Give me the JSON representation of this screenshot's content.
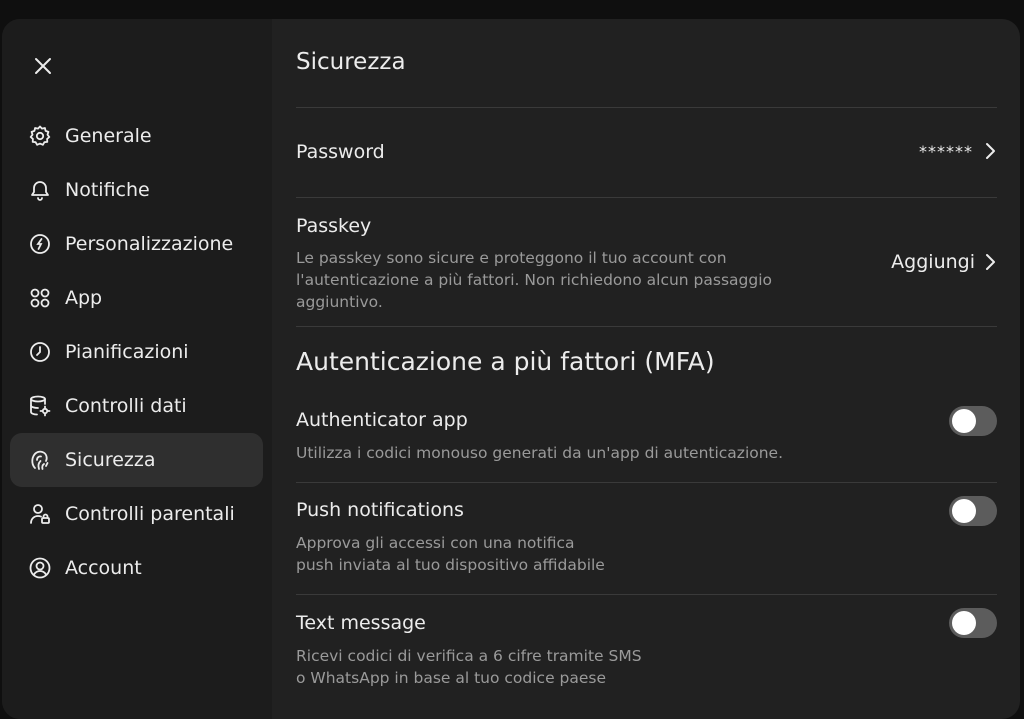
{
  "sidebar": {
    "items": [
      {
        "label": "Generale",
        "icon": "gear-icon"
      },
      {
        "label": "Notifiche",
        "icon": "bell-icon"
      },
      {
        "label": "Personalizzazione",
        "icon": "personalization-icon"
      },
      {
        "label": "App",
        "icon": "apps-grid-icon"
      },
      {
        "label": "Pianificazioni",
        "icon": "clock-icon"
      },
      {
        "label": "Controlli dati",
        "icon": "database-gear-icon"
      },
      {
        "label": "Sicurezza",
        "icon": "security-icon",
        "active": true
      },
      {
        "label": "Controlli parentali",
        "icon": "parent-lock-icon"
      },
      {
        "label": "Account",
        "icon": "user-circle-icon"
      }
    ]
  },
  "main": {
    "title": "Sicurezza",
    "password": {
      "label": "Password",
      "value": "******"
    },
    "passkey": {
      "label": "Passkey",
      "description_line1": "Le passkey sono sicure e proteggono il tuo account con",
      "description_line2": "l'autenticazione a più fattori. Non richiedono alcun passaggio",
      "description_line3": "aggiuntivo.",
      "action": "Aggiungi"
    },
    "mfa": {
      "title": "Autenticazione a più fattori (MFA)",
      "authenticator": {
        "label": "Authenticator app",
        "description": "Utilizza i codici monouso generati da un'app di autenticazione.",
        "enabled": false
      },
      "push": {
        "label": "Push notifications",
        "description_line1": "Approva gli accessi con una notifica",
        "description_line2": "push inviata al tuo dispositivo affidabile",
        "enabled": false
      },
      "sms": {
        "label": "Text message",
        "description_line1": "Ricevi codici di verifica a 6 cifre tramite SMS",
        "description_line2": "o WhatsApp in base al tuo codice paese",
        "enabled": false
      }
    }
  }
}
